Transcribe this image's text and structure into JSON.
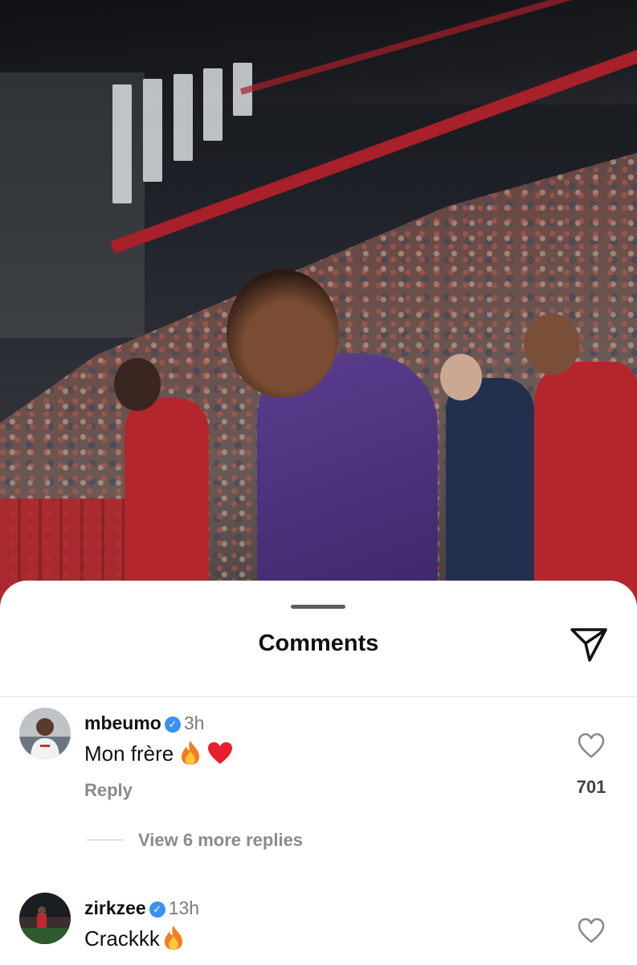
{
  "sheet": {
    "title": "Comments"
  },
  "comments": [
    {
      "username": "mbeumo",
      "verified": true,
      "time": "3h",
      "text": "Mon frère",
      "emojis": [
        "fire-emoji",
        "red-heart-emoji"
      ],
      "reply_label": "Reply",
      "likes": "701",
      "view_replies_label": "View 6 more replies"
    },
    {
      "username": "zirkzee",
      "verified": true,
      "time": "13h",
      "text": "Crackkk",
      "emojis": [
        "fire-emoji"
      ]
    }
  ],
  "icons": {
    "send": "paper-plane-icon",
    "like": "heart-outline-icon",
    "verified": "verified-badge-icon",
    "verified_glyph": "✓"
  },
  "colors": {
    "verified_blue": "#3b91f5",
    "secondary_text": "#8a8a8a",
    "sheet_background": "#ffffff"
  }
}
